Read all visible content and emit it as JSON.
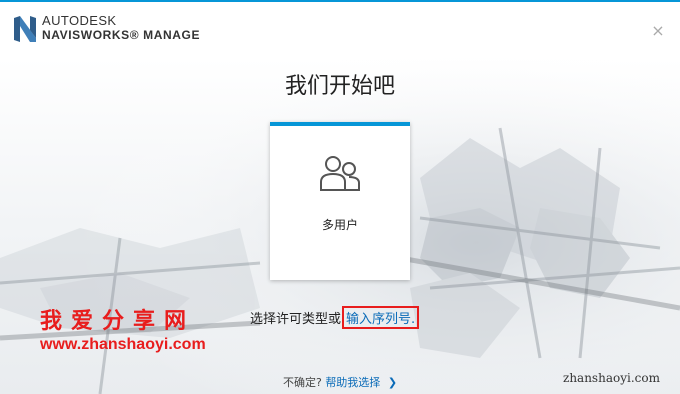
{
  "header": {
    "brand_line1": "AUTODESK",
    "brand_line2": "NAVISWORKS® MANAGE",
    "close_glyph": "×",
    "accent": "#0696d7"
  },
  "main": {
    "title": "我们开始吧",
    "options": [
      {
        "label": "多用户",
        "icon": "users-icon"
      }
    ]
  },
  "license": {
    "prompt": "选择许可类型或",
    "serial_link": "输入序列号."
  },
  "footer": {
    "unsure": "不确定?",
    "help_link": "帮助我选择",
    "chevron": "❯"
  },
  "watermark": {
    "cn": "我爱分享网",
    "url": "www.zhanshaoyi.com",
    "site": "zhanshaoyi.com",
    "color": "#e81d1d"
  }
}
